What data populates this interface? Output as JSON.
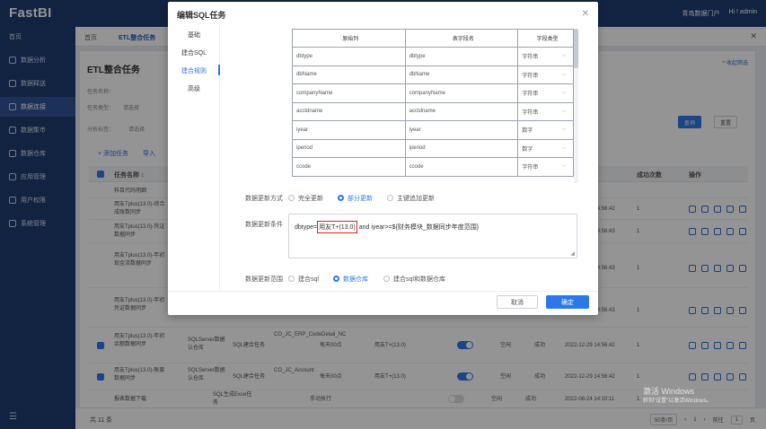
{
  "app": {
    "logo": "FastBI",
    "tenant": "青岛数据门户",
    "user": "Hi ! admin"
  },
  "sidebar": {
    "items": [
      {
        "label": "首页"
      },
      {
        "label": "数据分析"
      },
      {
        "label": "数据释送"
      },
      {
        "label": "数据连接"
      },
      {
        "label": "数据集市"
      },
      {
        "label": "数据仓库"
      },
      {
        "label": "应用管理"
      },
      {
        "label": "用户权限"
      },
      {
        "label": "系统管理"
      }
    ],
    "footer_icon": "☰"
  },
  "tabs": [
    "首页",
    "ETL整合任务"
  ],
  "page": {
    "title": "ETL整合任务",
    "top_link": "^ 收起筛选",
    "filters": [
      "任务名称：",
      "任务类型：",
      "分析标签："
    ],
    "filter_placeholders": [
      "",
      "请选择",
      "请选择"
    ],
    "query_button": "查询",
    "reset_button": "重置",
    "add_task": "+ 添加任务",
    "import": "导入",
    "columns": {
      "name": "任务名称 ↕",
      "success_count": "成功次数",
      "ops": "操作"
    },
    "rows": [
      {
        "name": "科目代码明细",
        "time": "",
        "count": ""
      },
      {
        "name": "用友Tplus(13.0)-综合成账数同步",
        "time": "2022-12-29 14:56:42",
        "count": "1"
      },
      {
        "name": "用友Tplus(13.0)-凭证数据同步",
        "time": "2022-12-29 14:56:43",
        "count": "1"
      },
      {
        "name": "用友Tplus(13.0)-年初现金流数据同步",
        "time": "2022-12-29 14:56:43",
        "count": "1"
      },
      {
        "name": "用友Tplus(13.0)-年初凭证数据同步",
        "time": "2022-12-29 14:56:43",
        "count": "1"
      }
    ],
    "bottom_rows": [
      {
        "name": "用友Tplus(13.0)-年初余额数据同步",
        "type": "SQLServer数据认仓库",
        "etl": "SQL建合任务",
        "code": "CO_JC_ERP_CodeDetail_NC",
        "freq": "每天00点",
        "source": "用友T+(13.0)",
        "flag": "空闲",
        "status": "成功",
        "time": "2022-12-29 14:56:42",
        "count": "1",
        "on": true
      },
      {
        "name": "用友Tplus(13.0)-账套数据同步",
        "type": "SQLServer数据认仓库",
        "etl": "SQL建合任务",
        "code": "CO_JC_Account",
        "freq": "每天00点",
        "source": "用友T+(13.0)",
        "flag": "空闲",
        "status": "成功",
        "time": "2022-12-29 14:56:42",
        "count": "1",
        "on": true
      },
      {
        "name": "报表数据下载",
        "type": "",
        "etl": "SQL生成Exce任务",
        "code": "",
        "freq": "手动执行",
        "source": "",
        "flag": "空闲",
        "status": "成功",
        "time": "2022-08-24 14:10:11",
        "count": "1",
        "on": false
      }
    ],
    "footer_total": "共 11 条",
    "page_size": "50条/页",
    "current_page": "1",
    "goto_label": "前往",
    "goto_value": "1",
    "goto_suffix": "页"
  },
  "watermark": {
    "line1": "激活 Windows",
    "line2": "转到\"设置\"以激活Windows。"
  },
  "modal": {
    "title": "编辑SQL任务",
    "nav": [
      "基础",
      "建合SQL",
      "建合规则",
      "高级"
    ],
    "active_nav": 2,
    "table_headers": [
      "原始列",
      "表字段名",
      "字段类型"
    ],
    "table_rows": [
      [
        "dbtype",
        "dbtype",
        "字符串"
      ],
      [
        "dbName",
        "dbName",
        "字符串"
      ],
      [
        "companyName",
        "companyName",
        "字符串"
      ],
      [
        "acctdname",
        "acctdname",
        "字符串"
      ],
      [
        "iyear",
        "iyear",
        "数字"
      ],
      [
        "iperiod",
        "iperiod",
        "数字"
      ],
      [
        "ccode",
        "ccode",
        "字符串"
      ]
    ],
    "update_mode_label": "数据更新方式",
    "update_modes": [
      "完全更新",
      "部分更新",
      "主键追加更新"
    ],
    "update_mode_selected": 1,
    "condition_label": "数据更新条件",
    "condition_prefix": "dbtype=",
    "condition_highlight": "用友T+(13.0)",
    "condition_suffix": " and  iyear>=${财务模块_数据同步年度范围}",
    "range_label": "数据更新范围",
    "ranges": [
      "建合sql",
      "数据仓库",
      "建合sql和数据仓库"
    ],
    "range_selected": 1,
    "cancel": "取消",
    "ok": "确定"
  }
}
